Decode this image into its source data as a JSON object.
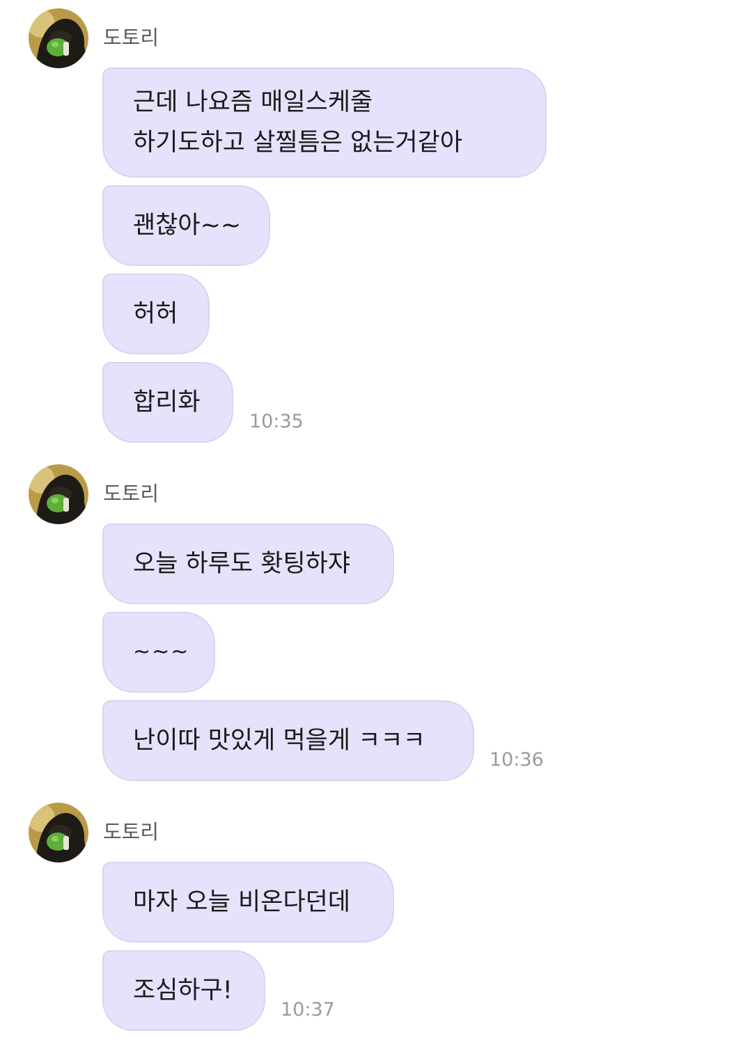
{
  "groups": [
    {
      "sender": "도토리",
      "messages": [
        {
          "lines": [
            "근데 나요즘 매일스케줄",
            "하기도하고 살찔틈은 없는거같아"
          ]
        },
        {
          "lines": [
            "괜찮아~~"
          ]
        },
        {
          "lines": [
            "허허"
          ]
        },
        {
          "lines": [
            "합리화"
          ]
        }
      ],
      "time": "10:35"
    },
    {
      "sender": "도토리",
      "messages": [
        {
          "lines": [
            "오늘 하루도 홧팅하쟈"
          ]
        },
        {
          "lines": [
            "~~~"
          ]
        },
        {
          "lines": [
            "난이따 맛있게 먹을게 ㅋㅋㅋ"
          ]
        }
      ],
      "time": "10:36"
    },
    {
      "sender": "도토리",
      "messages": [
        {
          "lines": [
            "마자 오늘 비온다던데"
          ]
        },
        {
          "lines": [
            "조심하구!"
          ]
        }
      ],
      "time": "10:37"
    }
  ],
  "colors": {
    "bubble": "#e5e2fb",
    "bubble_border": "#d8d4f2",
    "sender_text": "#5a5a5a",
    "time_text": "#9a9a9a"
  }
}
